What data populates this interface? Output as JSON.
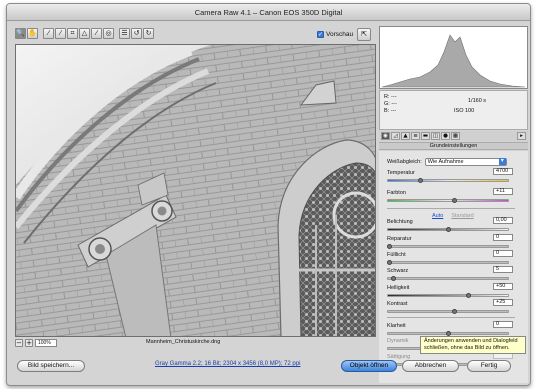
{
  "window": {
    "title": "Camera Raw 4.1 – Canon EOS 350D Digital"
  },
  "toolbar": {
    "tools": [
      {
        "name": "zoom-tool-icon",
        "glyph": "🔍",
        "active": true
      },
      {
        "name": "hand-tool-icon",
        "glyph": "✋"
      },
      {
        "name": "white-balance-tool-icon",
        "glyph": "⁄"
      },
      {
        "name": "color-sampler-tool-icon",
        "glyph": "⁄"
      },
      {
        "name": "crop-tool-icon",
        "glyph": "⌗"
      },
      {
        "name": "straighten-tool-icon",
        "glyph": "△"
      },
      {
        "name": "retouch-tool-icon",
        "glyph": "⁄"
      },
      {
        "name": "red-eye-tool-icon",
        "glyph": "◎"
      },
      {
        "name": "preferences-icon",
        "glyph": "☰"
      },
      {
        "name": "rotate-left-icon",
        "glyph": "↺"
      },
      {
        "name": "rotate-right-icon",
        "glyph": "↻"
      }
    ],
    "preview_label": "Vorschau",
    "preview_checked": true
  },
  "canvas": {
    "zoom_level": "100%",
    "filename": "Mannheim_Christuskirche.dng"
  },
  "histogram": {
    "rgb_lines": [
      "R:  ---",
      "G:  ---",
      "B:  ---"
    ],
    "shutter": "1/160 s",
    "iso": "ISO 100"
  },
  "panel": {
    "section_title": "Grundeinstellungen",
    "white_balance_label": "Weißabgleich:",
    "white_balance_value": "Wie Aufnahme",
    "auto_label": "Auto",
    "standard_label": "Standard",
    "sliders": [
      {
        "key": "temperatur",
        "label": "Temperatur",
        "value": "4700",
        "pos": 0.27
      },
      {
        "key": "farbton",
        "label": "Farbton",
        "value": "+11",
        "pos": 0.55
      },
      {
        "key": "belichtung",
        "label": "Belichtung",
        "value": "0,00",
        "pos": 0.5
      },
      {
        "key": "reparatur",
        "label": "Reparatur",
        "value": "0",
        "pos": 0.02
      },
      {
        "key": "fuelllicht",
        "label": "Fülllicht",
        "value": "0",
        "pos": 0.02
      },
      {
        "key": "schwarz",
        "label": "Schwarz",
        "value": "5",
        "pos": 0.05
      },
      {
        "key": "helligkeit",
        "label": "Helligkeit",
        "value": "+50",
        "pos": 0.66
      },
      {
        "key": "kontrast",
        "label": "Kontrast",
        "value": "+25",
        "pos": 0.55
      },
      {
        "key": "klarheit",
        "label": "Klarheit",
        "value": "0",
        "pos": 0.5
      },
      {
        "key": "dynamik",
        "label": "Dynamik",
        "value": "",
        "pos": 0.5,
        "disabled": true
      },
      {
        "key": "saettigung",
        "label": "Sättigung",
        "value": "",
        "pos": 0.5,
        "disabled": true
      }
    ]
  },
  "footer": {
    "save_label": "Bild speichern...",
    "workflow_link": "Gray Gamma 2.2; 16 Bit; 2304 x 3456 (8,0 MP); 72 ppi",
    "open_label": "Objekt öffnen",
    "cancel_label": "Abbrechen",
    "done_label": "Fertig",
    "tooltip": "Änderungen anwenden und Dialogfeld schließen, ohne das Bild zu öffnen."
  },
  "colors": {
    "accent": "#3d84dc",
    "link": "#1a3fa8"
  }
}
